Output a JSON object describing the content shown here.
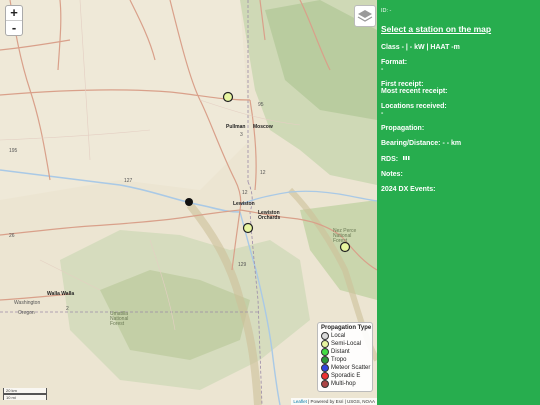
{
  "map": {
    "zoom_in": "+",
    "zoom_out": "-",
    "places": {
      "pullman": "Pullman",
      "moscow": "Moscow",
      "lewiston": "Lewiston",
      "lewiston_orchards": "Lewiston Orchards",
      "walla_walla": "Walla Walla",
      "washington": "Washington",
      "oregon": "Oregon",
      "umatilla": "Umatilla National Forest",
      "nez_perce": "Nez Perce National Forest"
    },
    "routes": [
      "195",
      "95",
      "12",
      "3",
      "26",
      "127",
      "129",
      "12",
      "2"
    ],
    "legend": {
      "title": "Propagation Type",
      "items": [
        {
          "label": "Local",
          "color": "#d9d9d9"
        },
        {
          "label": "Semi-Local",
          "color": "#e8f5a0"
        },
        {
          "label": "Distant",
          "color": "#44dd44"
        },
        {
          "label": "Tropo",
          "color": "#2e9a3a"
        },
        {
          "label": "Meteor Scatter",
          "color": "#3344dd"
        },
        {
          "label": "Sporadic E",
          "color": "#ee3333"
        },
        {
          "label": "Multi-hop",
          "color": "#aa4444"
        }
      ]
    },
    "scale": {
      "km": "20 km",
      "mi": "10 mi"
    },
    "attribution": {
      "leaflet": "Leaflet",
      "rest": " | Powered by Esri | USGS, NOAA"
    }
  },
  "panel": {
    "id_label": "ID: -",
    "select_link": "Select a station on the map",
    "class_line": "Class - | - kW | HAAT -m",
    "format_label": "Format:",
    "format_value": "-",
    "first_receipt": "First receipt:",
    "recent_receipt": "Most recent receipt:",
    "locations_label": "Locations received:",
    "locations_value": "-",
    "propagation": "Propagation:",
    "bearing": "Bearing/Distance: - - km",
    "rds_label": "RDS:",
    "notes": "Notes:",
    "dx_events": "2024 DX Events:"
  }
}
